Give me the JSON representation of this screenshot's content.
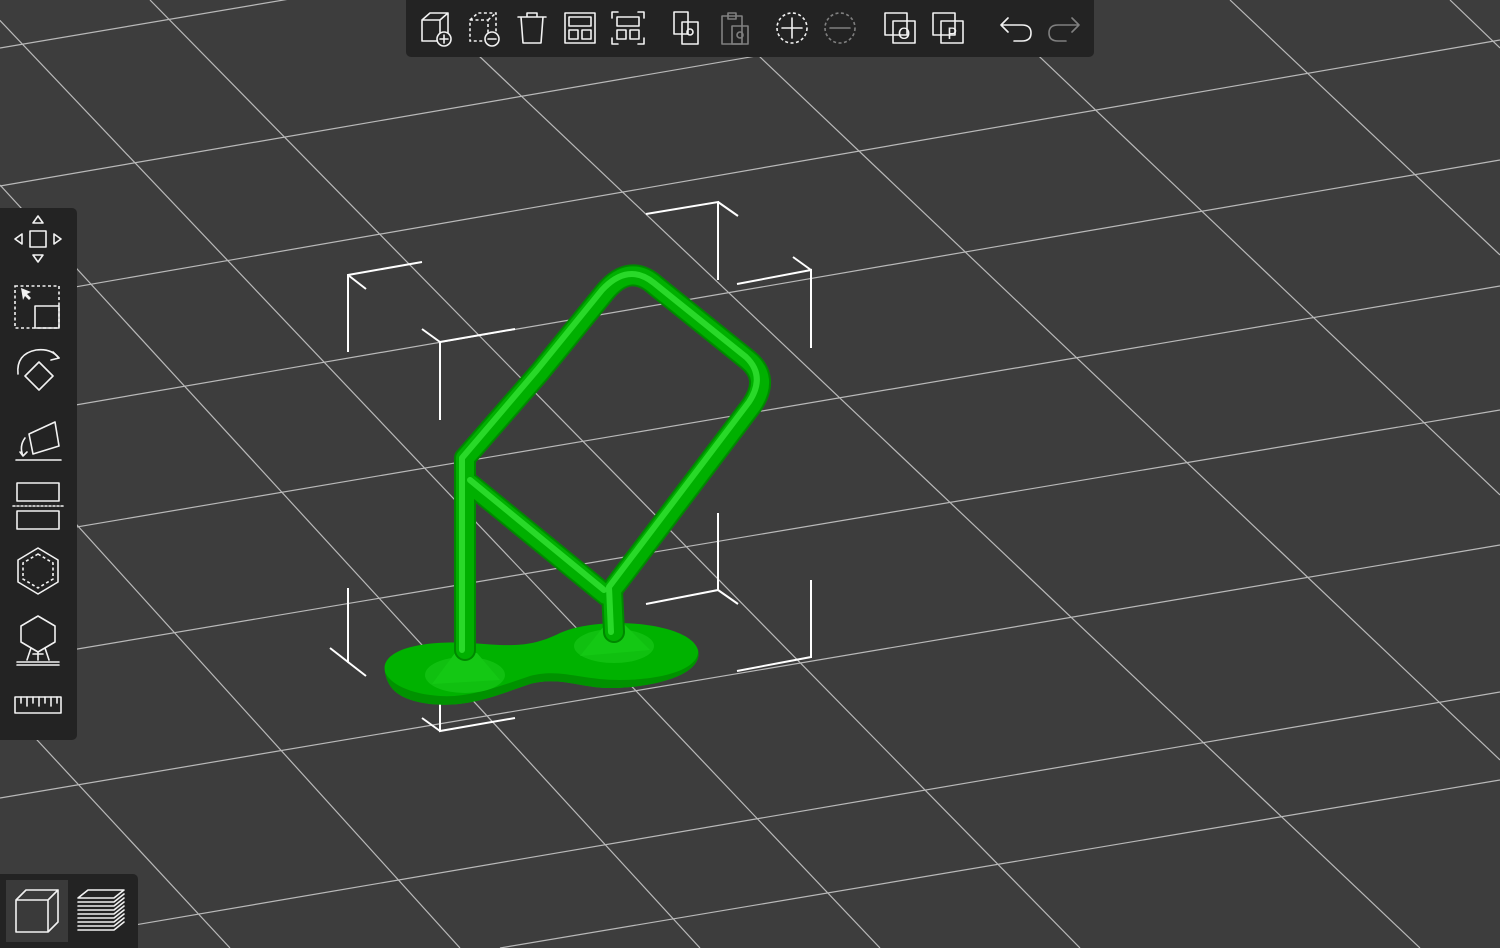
{
  "app": {
    "theme": {
      "background": "#3d3d3d",
      "grid_line": "#cfcfcf",
      "toolbar_bg": "#232323",
      "model_color": "#00b400",
      "icon_color": "#f2f2f2"
    }
  },
  "top_toolbar": {
    "buttons": [
      {
        "id": "add",
        "icon": "add-object-icon",
        "enabled": true
      },
      {
        "id": "delete",
        "icon": "delete-object-icon",
        "enabled": true
      },
      {
        "id": "delete-all",
        "icon": "trash-icon",
        "enabled": true
      },
      {
        "id": "arrange",
        "icon": "arrange-icon",
        "enabled": true
      },
      {
        "id": "arrange-selection",
        "icon": "arrange-selection-icon",
        "enabled": true
      },
      {
        "id": "copy",
        "icon": "copy-icon",
        "enabled": true
      },
      {
        "id": "paste",
        "icon": "paste-icon",
        "enabled": false
      },
      {
        "id": "add-instance",
        "icon": "add-instance-icon",
        "enabled": true
      },
      {
        "id": "remove-instance",
        "icon": "remove-instance-icon",
        "enabled": false
      },
      {
        "id": "split-objects",
        "icon": "split-objects-icon",
        "label": "O",
        "enabled": true
      },
      {
        "id": "split-parts",
        "icon": "split-parts-icon",
        "label": "P",
        "enabled": true
      },
      {
        "id": "undo",
        "icon": "undo-icon",
        "enabled": true
      },
      {
        "id": "redo",
        "icon": "redo-icon",
        "enabled": false
      }
    ]
  },
  "left_toolbar": {
    "tools": [
      {
        "id": "move",
        "icon": "move-icon"
      },
      {
        "id": "scale",
        "icon": "scale-icon"
      },
      {
        "id": "rotate",
        "icon": "rotate-icon"
      },
      {
        "id": "place-on-face",
        "icon": "place-on-face-icon"
      },
      {
        "id": "cut",
        "icon": "cut-icon"
      },
      {
        "id": "hollow",
        "icon": "hollow-icon"
      },
      {
        "id": "supports",
        "icon": "support-points-icon"
      },
      {
        "id": "measure",
        "icon": "ruler-icon"
      }
    ]
  },
  "view_switch": {
    "buttons": [
      {
        "id": "3d-view",
        "icon": "cube-3d-view-icon",
        "active": true
      },
      {
        "id": "preview",
        "icon": "layers-preview-icon",
        "active": false
      }
    ]
  }
}
